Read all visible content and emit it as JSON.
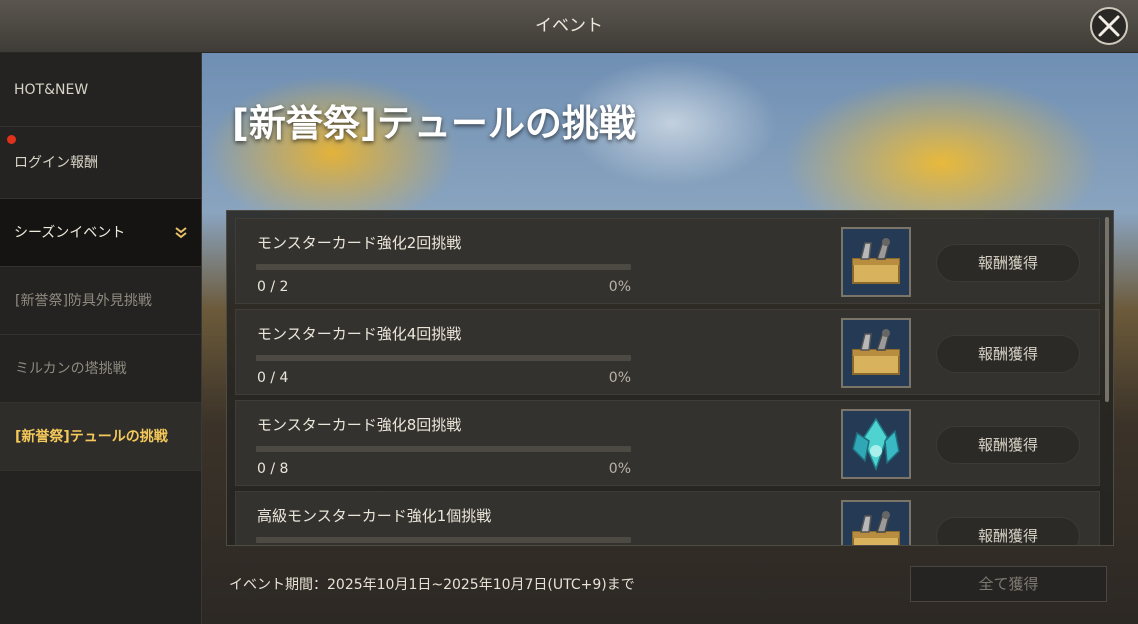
{
  "window": {
    "title": "イベント",
    "close_icon": "close-icon"
  },
  "sidebar": {
    "items": [
      {
        "label": "HOT&NEW"
      },
      {
        "label": "ログイン報酬",
        "notification_dot": true
      },
      {
        "label": "シーズンイベント",
        "icon": "chevron-down-icon"
      },
      {
        "label": "[新誉祭]防具外見挑戦"
      },
      {
        "label": "ミルカンの塔挑戦"
      },
      {
        "label": "[新誉祭]テュールの挑戦",
        "selected": true
      }
    ]
  },
  "event": {
    "title": "[新誉祭]テュールの挑戦",
    "missions": [
      {
        "name": "モンスターカード強化2回挑戦",
        "progress": "0 / 2",
        "percent": "0%",
        "percent_value": 0,
        "reward_icon": "toolbox-icon",
        "button_label": "報酬獲得"
      },
      {
        "name": "モンスターカード強化4回挑戦",
        "progress": "0 / 4",
        "percent": "0%",
        "percent_value": 0,
        "reward_icon": "toolbox-icon",
        "button_label": "報酬獲得"
      },
      {
        "name": "モンスターカード強化8回挑戦",
        "progress": "0 / 8",
        "percent": "0%",
        "percent_value": 0,
        "reward_icon": "crystal-icon",
        "button_label": "報酬獲得"
      },
      {
        "name": "高級モンスターカード強化1個挑戦",
        "reward_icon": "toolbox-icon",
        "button_label": "報酬獲得"
      }
    ],
    "period": "イベント期間：2025年10月1日~2025年10月7日(UTC+9)まで",
    "claim_all_label": "全て獲得"
  },
  "colors": {
    "accent": "#f4c95a",
    "notification": "#e0311b"
  }
}
